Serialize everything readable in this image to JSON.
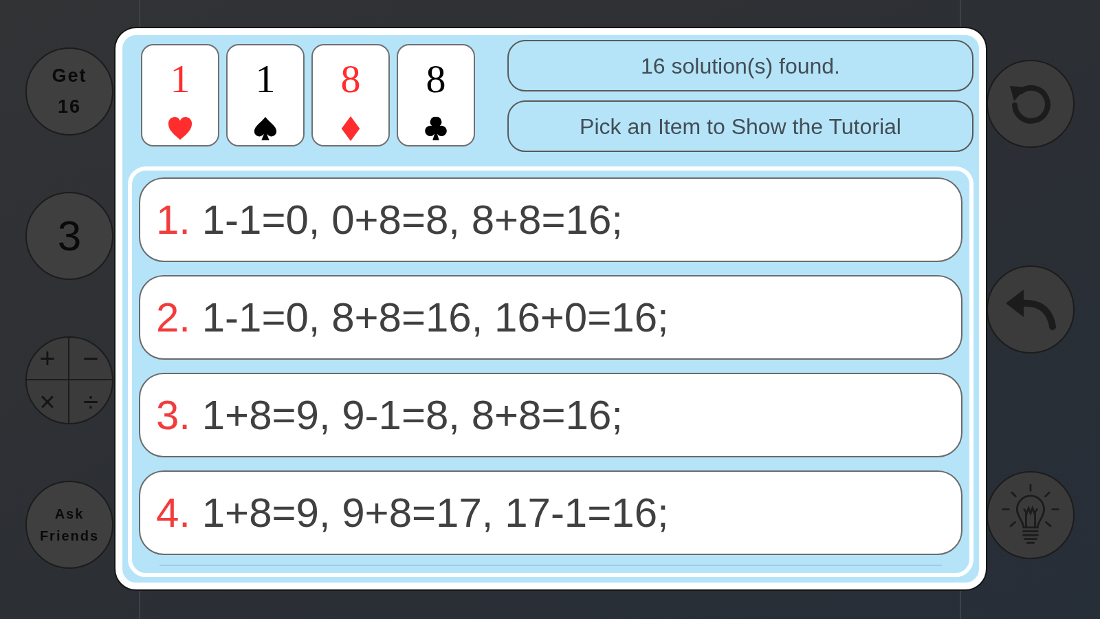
{
  "side_buttons": [
    {
      "kind": "text",
      "label": "Get 16"
    },
    {
      "kind": "text",
      "label": "3"
    },
    {
      "kind": "operators",
      "symbols": [
        "+",
        "−",
        "×",
        "÷"
      ]
    },
    {
      "kind": "text",
      "label": "Ask Friends"
    }
  ],
  "cards": [
    {
      "rank": "1",
      "kind": "heart"
    },
    {
      "rank": "1",
      "kind": "spade"
    },
    {
      "rank": "8",
      "kind": "diamond"
    },
    {
      "rank": "8",
      "kind": "club"
    }
  ],
  "status": {
    "message": "16 solution(s) found.",
    "instruction": "Pick an Item to Show the Tutorial"
  },
  "solutions": [
    {
      "number": "1.",
      "steps": "1-1=0, 0+8=8, 8+8=16;"
    },
    {
      "number": "2.",
      "steps": "1-1=0, 8+8=16, 16+0=16;"
    },
    {
      "number": "3.",
      "steps": "1+8=9, 9-1=8, 8+8=16;"
    },
    {
      "number": "4.",
      "steps": "1+8=9, 9+8=17, 17-1=16;"
    }
  ]
}
